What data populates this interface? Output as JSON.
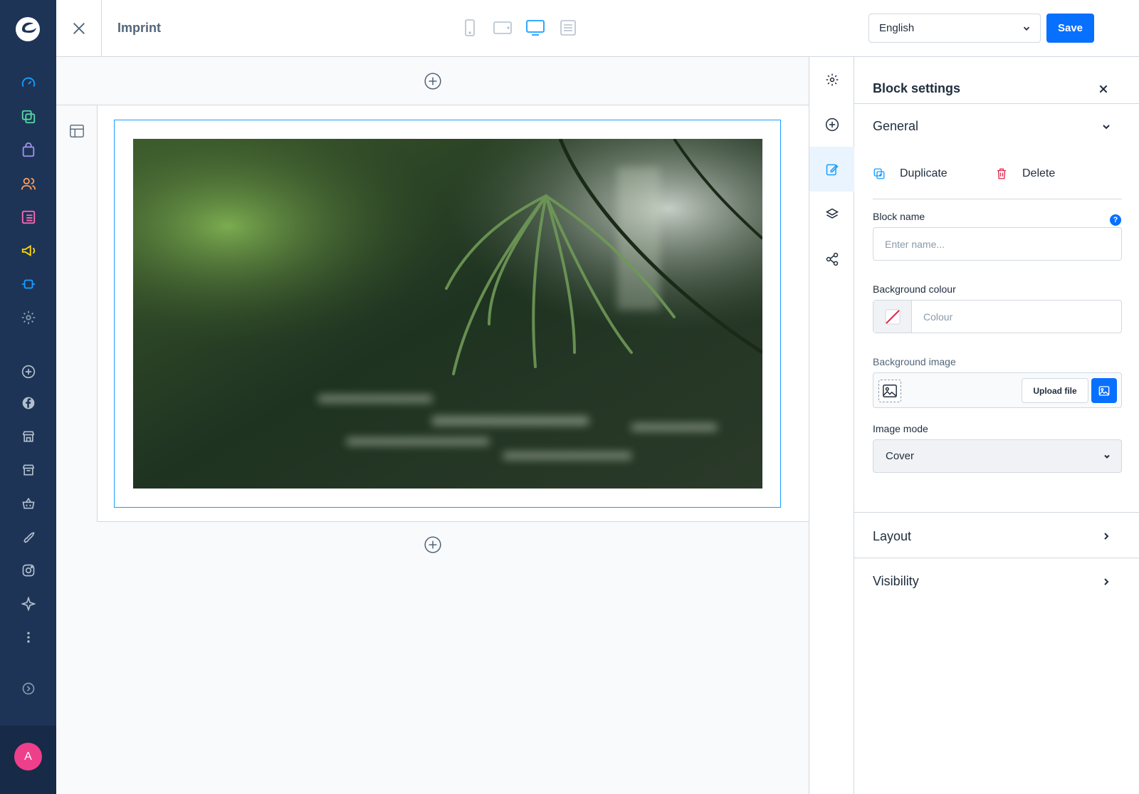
{
  "topbar": {
    "title": "Imprint",
    "language": "English",
    "save_label": "Save"
  },
  "panel": {
    "title": "Block settings",
    "general_label": "General",
    "duplicate_label": "Duplicate",
    "delete_label": "Delete",
    "block_name_label": "Block name",
    "block_name_placeholder": "Enter name...",
    "help_label": "?",
    "bg_colour_label": "Background colour",
    "colour_placeholder": "Colour",
    "bg_image_label": "Background image",
    "upload_label": "Upload file",
    "image_mode_label": "Image mode",
    "image_mode_value": "Cover",
    "layout_label": "Layout",
    "visibility_label": "Visibility"
  },
  "user": {
    "avatar_initial": "A"
  },
  "colors": {
    "nav_bg": "#1d3457",
    "accent": "#0870ff",
    "selection": "#189eff",
    "avatar": "#ee3f8b"
  },
  "nav_icons": [
    "dashboard-icon",
    "catalogues-icon",
    "orders-icon",
    "customers-icon",
    "content-icon",
    "marketing-icon",
    "extensions-icon",
    "settings-icon",
    "add-sales-channel-icon",
    "facebook-icon",
    "storefront-icon",
    "headless-icon",
    "shopping-basket-icon",
    "rocket-icon",
    "instagram-icon",
    "sparkle-icon",
    "more-icon",
    "expand-icon"
  ]
}
